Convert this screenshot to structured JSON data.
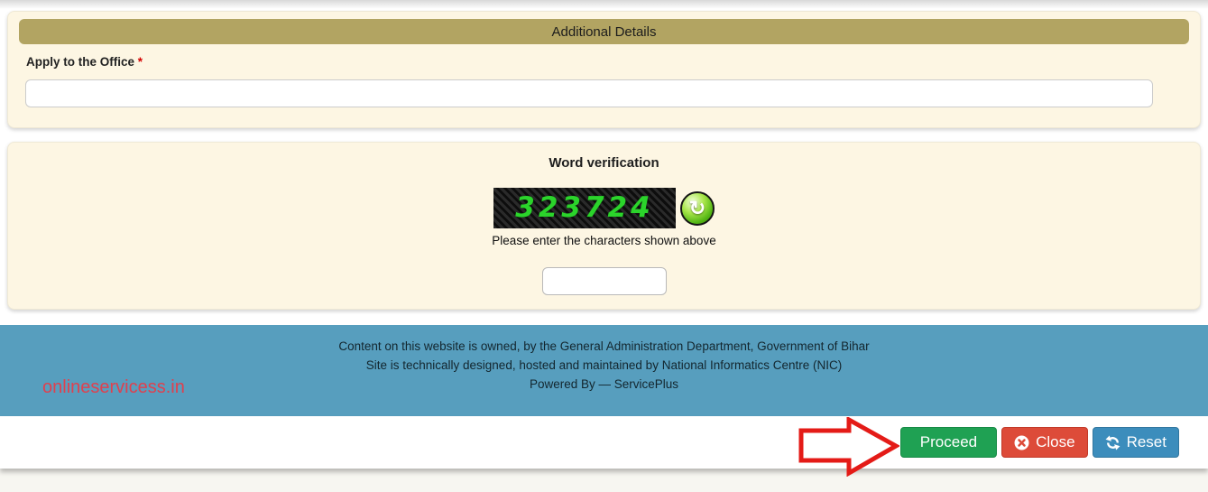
{
  "panel_additional": {
    "title": "Additional Details",
    "label": "Apply to the Office",
    "required_marker": "*",
    "input_value": ""
  },
  "word_verification": {
    "title": "Word verification",
    "captcha_code": "323724",
    "refresh_icon": "↻",
    "instruction": "Please enter the characters shown above",
    "input_value": ""
  },
  "footer": {
    "lines": [
      "Content on this website is owned, by the General Administration Department, Government of Bihar",
      "Site is technically designed, hosted and maintained by National Informatics Centre (NIC)",
      "Powered By — ServicePlus"
    ],
    "watermark": "onlineservicess.in"
  },
  "action_bar": {
    "proceed": "Proceed",
    "close": "Close",
    "reset": "Reset"
  },
  "colors": {
    "panel_bg": "#fdf6e3",
    "header_bar": "#b2a462",
    "footer_bg": "#579ebe",
    "proceed_green": "#1fa153",
    "close_red": "#dd4b39",
    "reset_blue": "#3c8dbc",
    "captcha_green": "#2bd42b",
    "watermark_red": "#e0404e",
    "annotation_red": "#e41b17"
  }
}
